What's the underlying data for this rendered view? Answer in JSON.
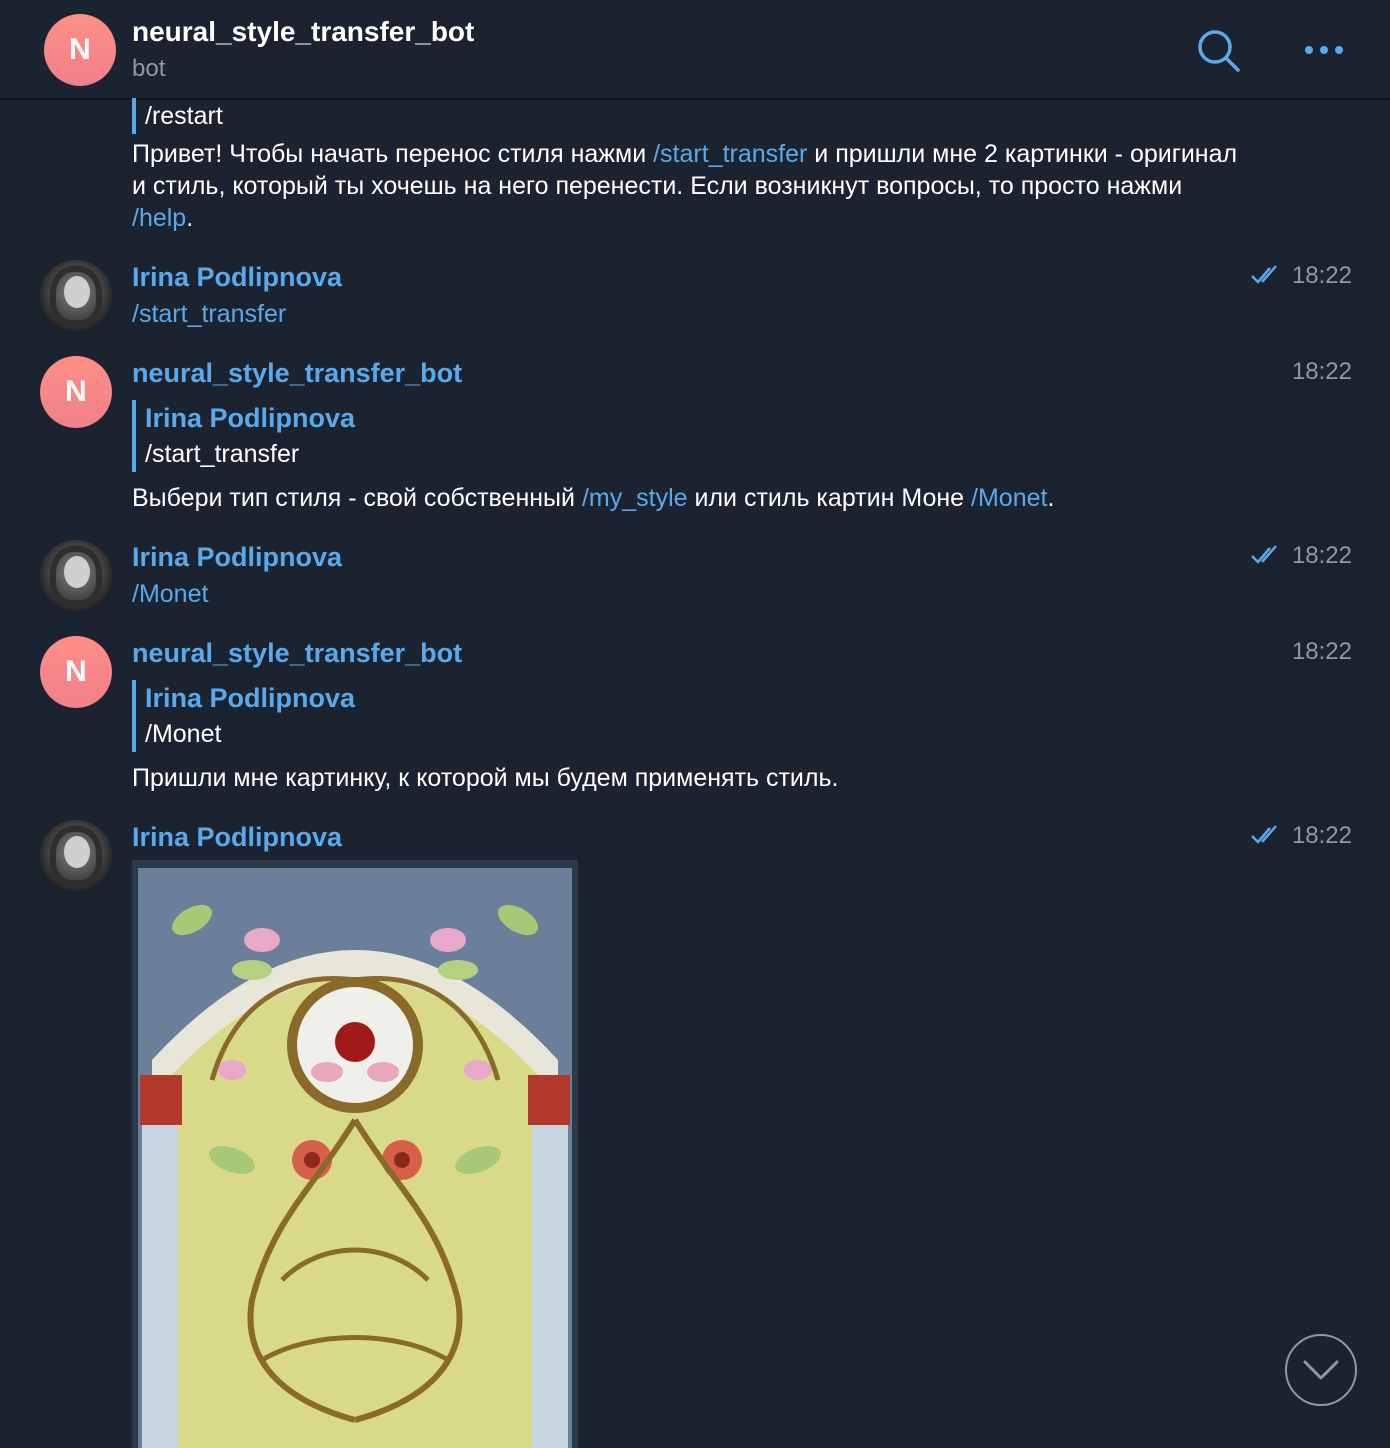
{
  "header": {
    "avatar_letter": "N",
    "title": "neural_style_transfer_bot",
    "subtitle": "bot"
  },
  "messages": [
    {
      "quote_text": "/restart",
      "text_parts": [
        "Привет! Чтобы начать перенос стиля нажми ",
        "/start_transfer",
        " и пришли мне 2 картинки - оригинал и стиль, который ты хочешь на него перенести. Если возникнут вопросы, то просто нажми ",
        "/help",
        "."
      ]
    },
    {
      "sender": "Irina Podlipnova",
      "text": "/start_transfer",
      "time": "18:22"
    },
    {
      "avatar_letter": "N",
      "sender": "neural_style_transfer_bot",
      "time": "18:22",
      "quote_name": "Irina Podlipnova",
      "quote_text": "/start_transfer",
      "text_parts": [
        "Выбери тип стиля - свой собственный ",
        "/my_style",
        " или стиль картин Моне ",
        "/Monet",
        "."
      ]
    },
    {
      "sender": "Irina Podlipnova",
      "text": "/Monet",
      "time": "18:22"
    },
    {
      "avatar_letter": "N",
      "sender": "neural_style_transfer_bot",
      "time": "18:22",
      "quote_name": "Irina Podlipnova",
      "quote_text": "/Monet",
      "text": "Пришли мне картинку, к которой мы будем применять стиль."
    },
    {
      "sender": "Irina Podlipnova",
      "time": "18:22",
      "photo": "stained-glass-window"
    }
  ],
  "colors": {
    "background": "#1c2330",
    "accent": "#5aa9ea",
    "muted": "#8d99a6",
    "avatar_gradient": [
      "#ff8f86",
      "#f07f8a"
    ]
  },
  "icons": [
    "search-icon",
    "more-icon",
    "double-check-icon",
    "chevron-down-icon"
  ]
}
